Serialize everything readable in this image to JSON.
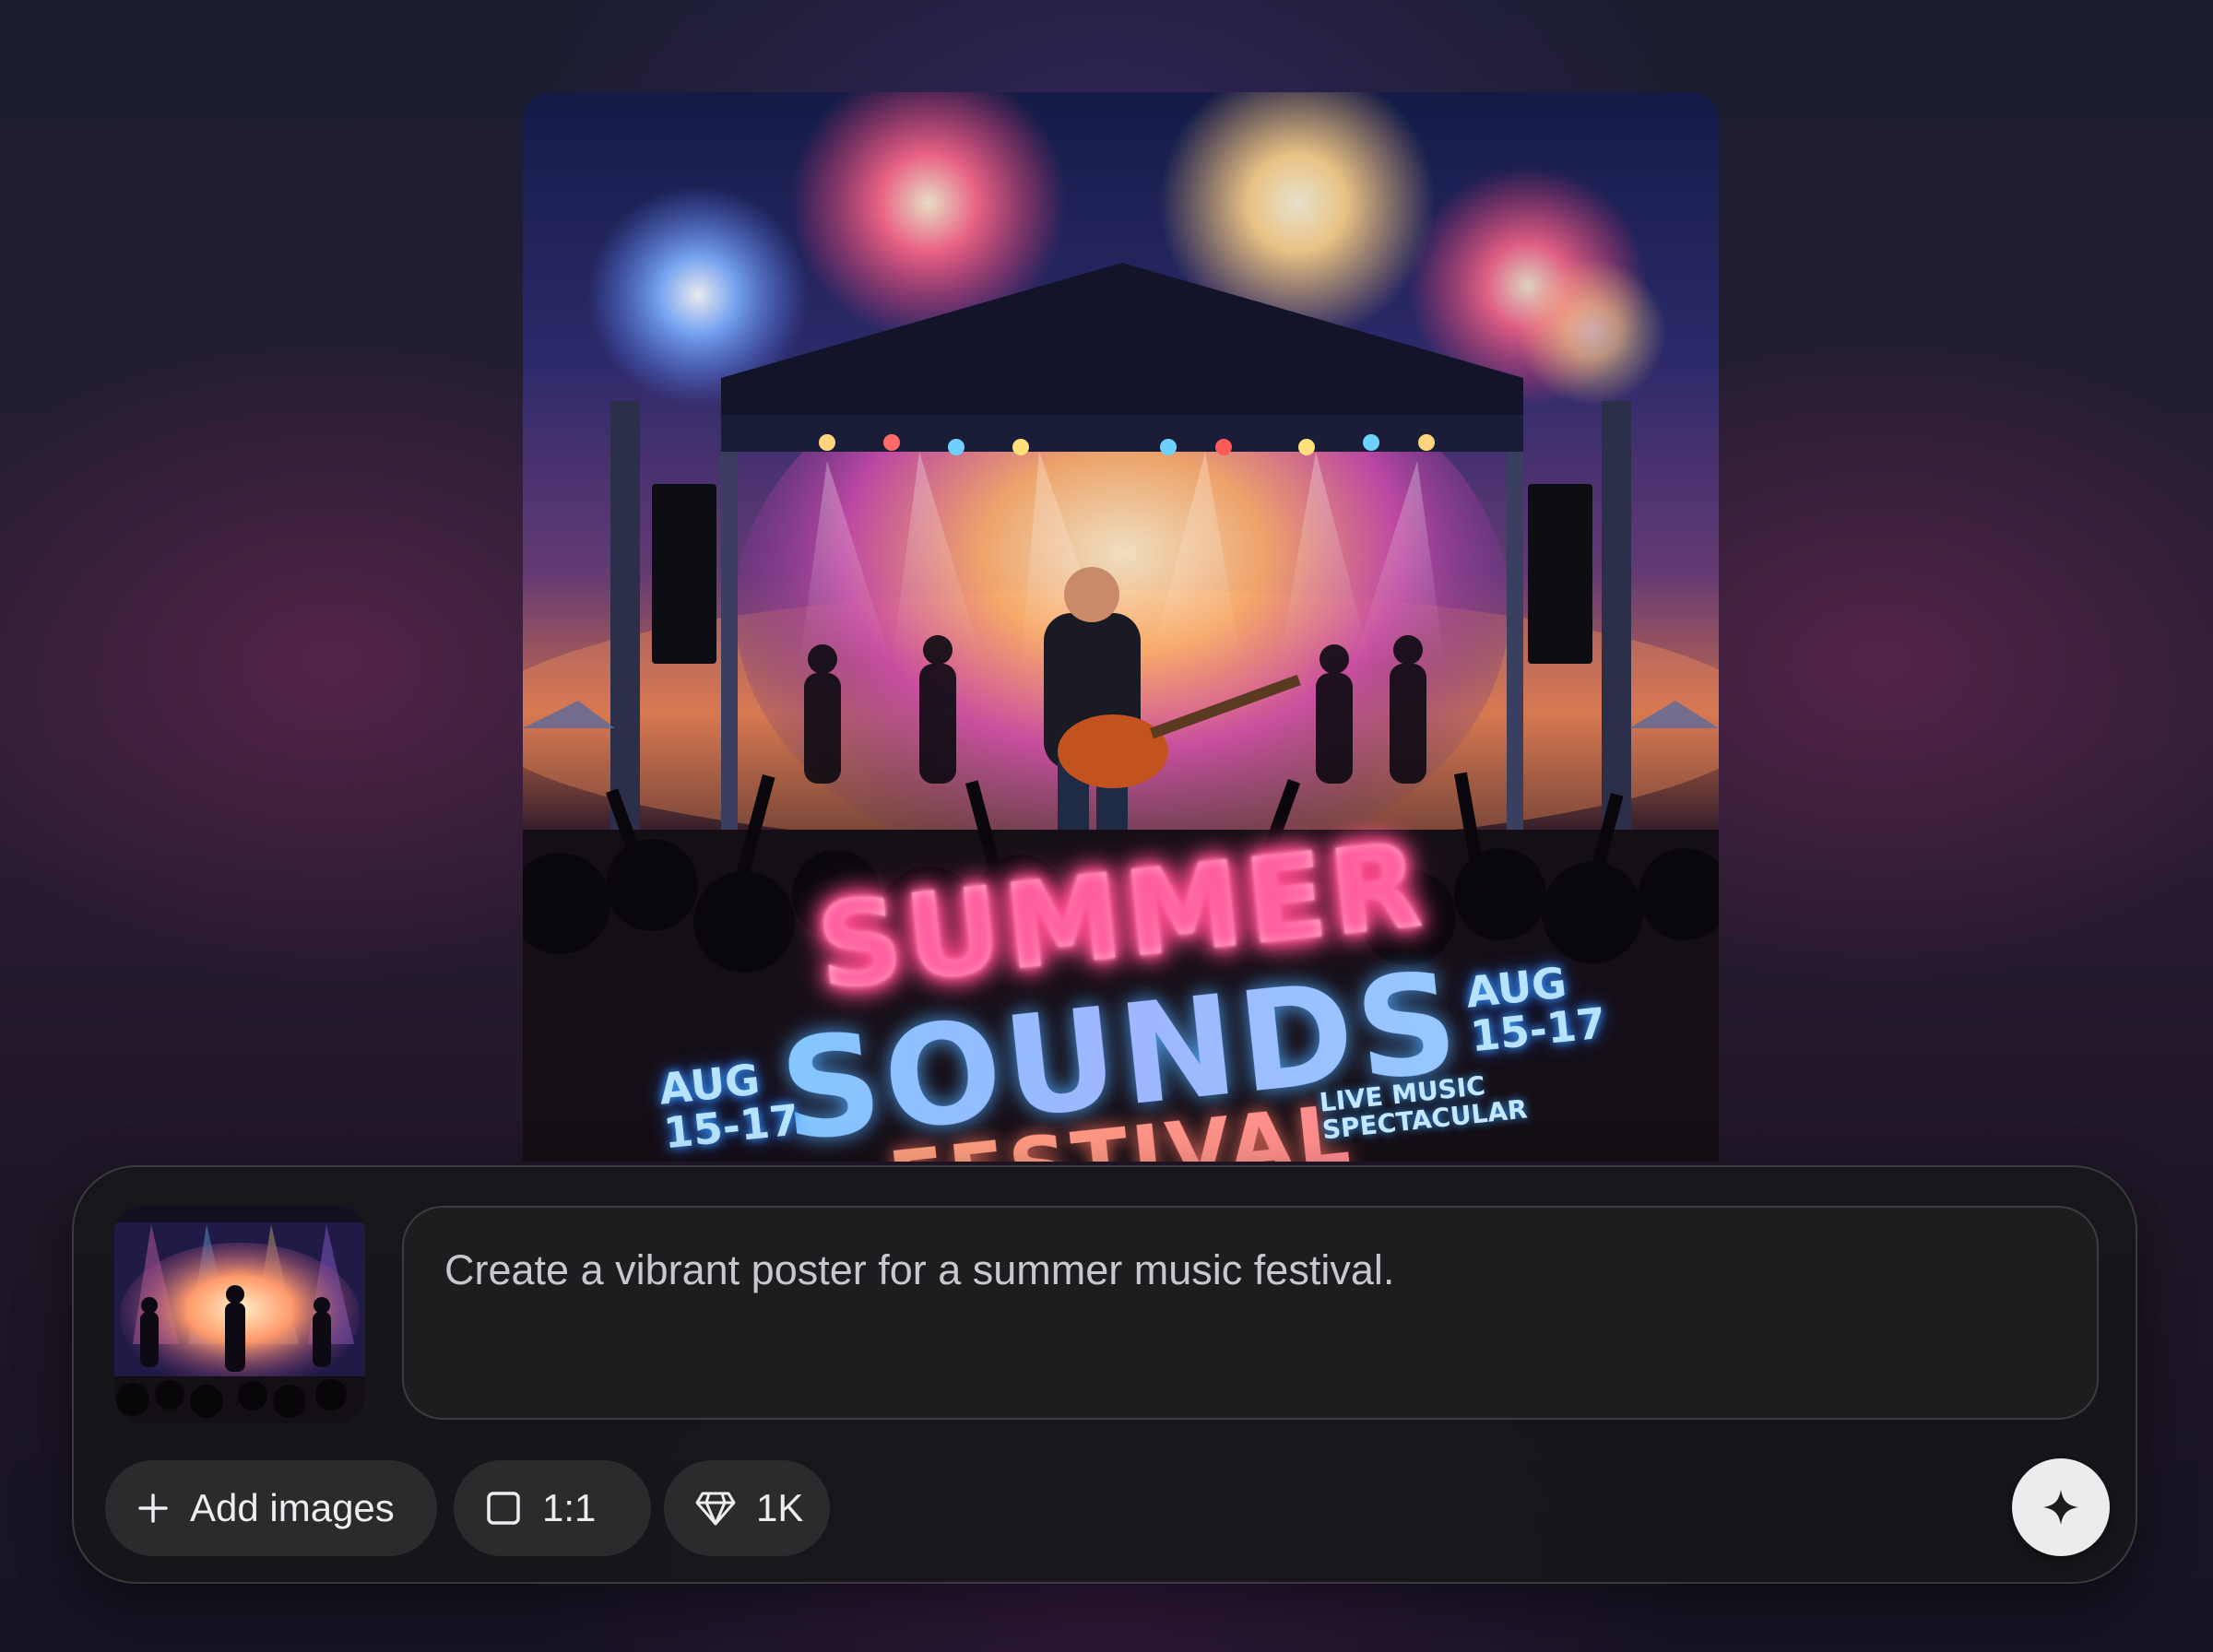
{
  "poster": {
    "title_line1": "SUMMER",
    "title_line2": "SOUNDS",
    "title_line3": "FESTIVAL",
    "date_left": "AUG\n15-17",
    "date_right": "AUG\n15-17",
    "tagline": "LIVE MUSIC\nSPECTACULAR"
  },
  "composer": {
    "prompt": "Create a vibrant poster for a summer music festival.",
    "add_images_label": "Add images",
    "aspect_ratio_label": "1:1",
    "quality_label": "1K"
  },
  "icons": {
    "add": "plus-icon",
    "ratio": "square-icon",
    "quality": "diamond-icon",
    "send": "sparkle-icon"
  }
}
